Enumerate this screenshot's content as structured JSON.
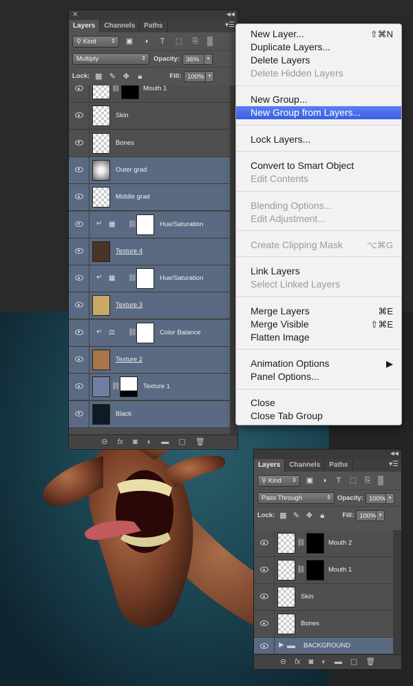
{
  "main_panel": {
    "tabs": [
      "Layers",
      "Channels",
      "Paths"
    ],
    "filter_kind": "Kind",
    "blend_mode": "Multiply",
    "opacity_label": "Opacity:",
    "opacity_value": "36%",
    "lock_label": "Lock:",
    "fill_label": "Fill:",
    "fill_value": "100%",
    "layers": [
      {
        "name": "Mouth 1",
        "selected": false
      },
      {
        "name": "Skin",
        "selected": false
      },
      {
        "name": "Bones",
        "selected": false
      },
      {
        "name": "Outer grad",
        "selected": true
      },
      {
        "name": "Middle grad",
        "selected": true
      },
      {
        "name": "Hue/Saturation",
        "selected": true
      },
      {
        "name": "Texture 4",
        "selected": true
      },
      {
        "name": "Hue/Saturation",
        "selected": true
      },
      {
        "name": "Texture 3",
        "selected": true
      },
      {
        "name": "Color Balance",
        "selected": true
      },
      {
        "name": "Texture 2",
        "selected": true
      },
      {
        "name": "Texture 1",
        "selected": true
      },
      {
        "name": "Black",
        "selected": true
      }
    ]
  },
  "context_menu": {
    "items": [
      {
        "label": "New Layer...",
        "shortcut": "⇧⌘N",
        "disabled": false
      },
      {
        "label": "Duplicate Layers...",
        "shortcut": "",
        "disabled": false
      },
      {
        "label": "Delete Layers",
        "shortcut": "",
        "disabled": false
      },
      {
        "label": "Delete Hidden Layers",
        "shortcut": "",
        "disabled": true
      },
      {
        "label": "New Group...",
        "shortcut": "",
        "disabled": false
      },
      {
        "label": "New Group from Layers...",
        "shortcut": "",
        "disabled": false,
        "highlighted": true
      },
      {
        "label": "Lock Layers...",
        "shortcut": "",
        "disabled": false
      },
      {
        "label": "Convert to Smart Object",
        "shortcut": "",
        "disabled": false
      },
      {
        "label": "Edit Contents",
        "shortcut": "",
        "disabled": true
      },
      {
        "label": "Blending Options...",
        "shortcut": "",
        "disabled": true
      },
      {
        "label": "Edit Adjustment...",
        "shortcut": "",
        "disabled": true
      },
      {
        "label": "Create Clipping Mask",
        "shortcut": "⌥⌘G",
        "disabled": true
      },
      {
        "label": "Link Layers",
        "shortcut": "",
        "disabled": false
      },
      {
        "label": "Select Linked Layers",
        "shortcut": "",
        "disabled": true
      },
      {
        "label": "Merge Layers",
        "shortcut": "⌘E",
        "disabled": false
      },
      {
        "label": "Merge Visible",
        "shortcut": "⇧⌘E",
        "disabled": false
      },
      {
        "label": "Flatten Image",
        "shortcut": "",
        "disabled": false
      },
      {
        "label": "Animation Options",
        "shortcut": "▶",
        "disabled": false
      },
      {
        "label": "Panel Options...",
        "shortcut": "",
        "disabled": false
      },
      {
        "label": "Close",
        "shortcut": "",
        "disabled": false
      },
      {
        "label": "Close Tab Group",
        "shortcut": "",
        "disabled": false
      }
    ]
  },
  "second_panel": {
    "tabs": [
      "Layers",
      "Channels",
      "Paths"
    ],
    "filter_kind": "Kind",
    "blend_mode": "Pass Through",
    "opacity_label": "Opacity:",
    "opacity_value": "100%",
    "lock_label": "Lock:",
    "fill_label": "Fill:",
    "fill_value": "100%",
    "layers": [
      {
        "name": "Mouth 2"
      },
      {
        "name": "Mouth 1"
      },
      {
        "name": "Skin"
      },
      {
        "name": "Bones"
      },
      {
        "name": "BACKGROUND"
      }
    ]
  },
  "colors": {
    "selected_row": "#5a6a82",
    "menu_highlight": "#3f63e7",
    "panel_bg": "#535353",
    "canvas_teal": "#1b4451"
  }
}
